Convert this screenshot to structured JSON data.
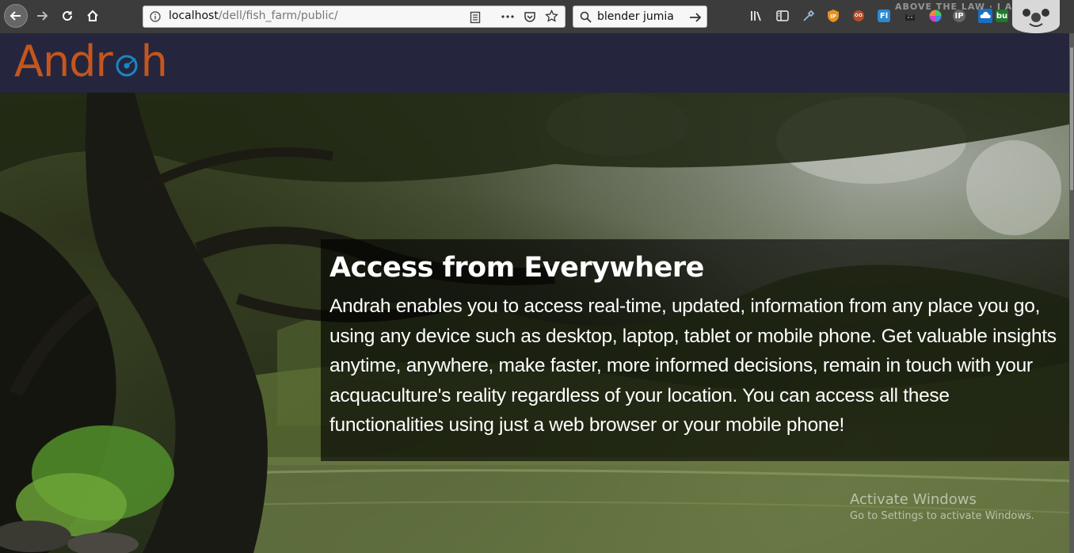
{
  "browser": {
    "url_prefix": "localhost",
    "url_path": "/dell/fish_farm/public/",
    "search_text": "blender jumia",
    "extensions": [
      "library-icon",
      "sidebar-icon",
      "eyedropper-icon",
      "ublock-icon",
      "privacy-badger-icon",
      "fl-extension",
      "cat-extension",
      "color-wheel-icon",
      "ip-extension",
      "onedrive-icon",
      "green-extension",
      "avatar-icon"
    ],
    "ext_labels": {
      "ip": "IP",
      "fl": "Fl",
      "ip2": "IP",
      "green": "bu"
    },
    "profile_watermark": "ABOVE THE LAW · I AM FREE"
  },
  "site": {
    "logo_text_start": "Andr",
    "logo_text_end": "h",
    "brand_color": "#c4561d",
    "ring_color": "#1a86c7"
  },
  "hero": {
    "title": "Access from Everywhere",
    "body": "Andrah enables you to access real-time, updated, information from any place you go, using any device such as desktop, laptop, tablet or mobile phone. Get valuable insights anytime, anywhere, make faster, more informed decisions, remain in touch with your acquaculture's reality regardless of your location. You can access all these functionalities using just a web browser or your mobile phone!"
  },
  "os_notice": {
    "title": "Activate Windows",
    "subtitle": "Go to Settings to activate Windows."
  }
}
